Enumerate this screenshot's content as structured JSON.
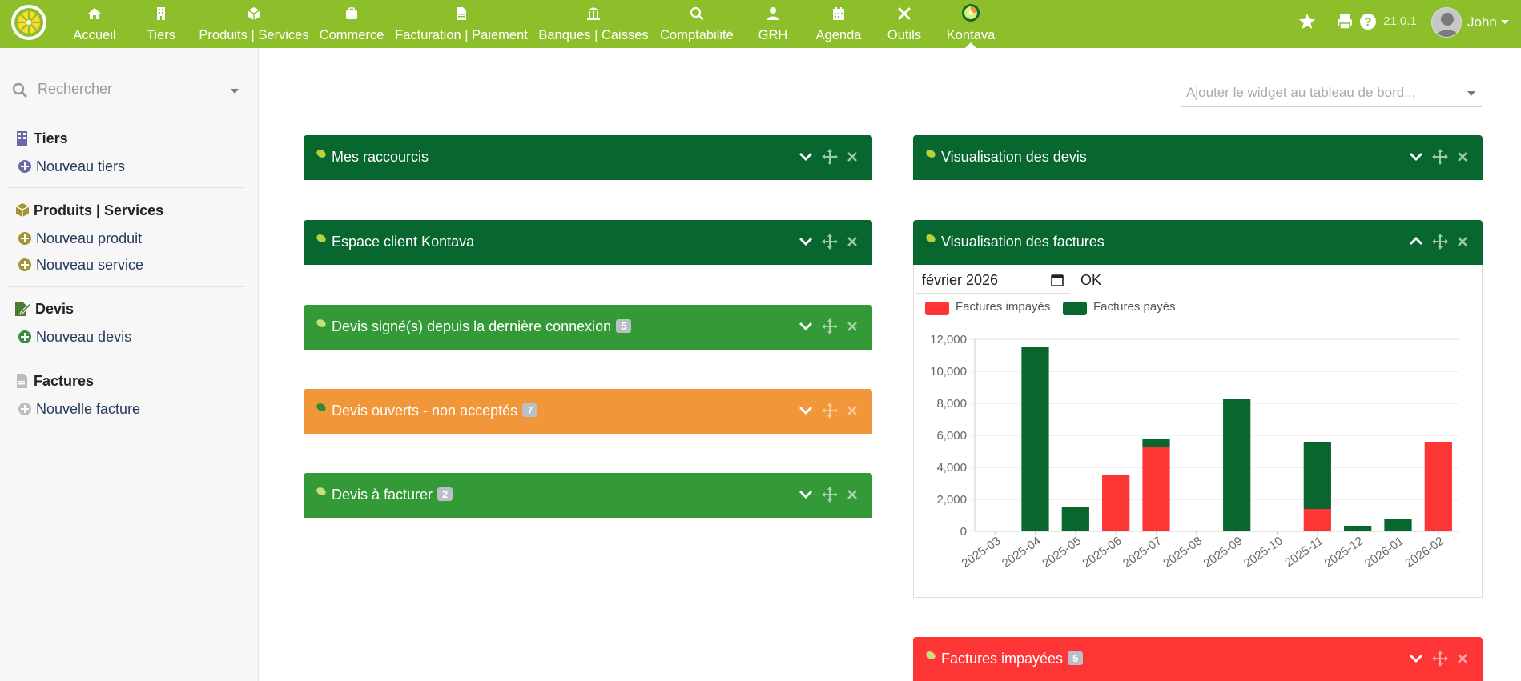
{
  "topbar": {
    "menu": [
      {
        "label": "Accueil",
        "icon": "home-icon"
      },
      {
        "label": "Tiers",
        "icon": "building-icon"
      },
      {
        "label": "Produits | Services",
        "icon": "cube-icon"
      },
      {
        "label": "Commerce",
        "icon": "suitcase-icon"
      },
      {
        "label": "Facturation | Paiement",
        "icon": "file-invoice-icon"
      },
      {
        "label": "Banques | Caisses",
        "icon": "bank-icon"
      },
      {
        "label": "Comptabilité",
        "icon": "search-dollar-icon"
      },
      {
        "label": "GRH",
        "icon": "user-tie-icon"
      },
      {
        "label": "Agenda",
        "icon": "calendar-icon"
      },
      {
        "label": "Outils",
        "icon": "tools-icon"
      },
      {
        "label": "Kontava",
        "icon": "kontava-logo-icon"
      }
    ],
    "version": "21.0.1",
    "user": "John"
  },
  "sidebar": {
    "search_placeholder": "Rechercher",
    "sections": [
      {
        "title": "Tiers",
        "links": [
          "Nouveau tiers"
        ]
      },
      {
        "title": "Produits | Services",
        "links": [
          "Nouveau produit",
          "Nouveau service"
        ]
      },
      {
        "title": "Devis",
        "links": [
          "Nouveau devis"
        ]
      },
      {
        "title": "Factures",
        "links": [
          "Nouvelle facture"
        ]
      }
    ]
  },
  "main": {
    "widget_select_placeholder": "Ajouter le widget au tableau de bord...",
    "boxes": [
      {
        "title": "Mes raccourcis",
        "badge": ""
      },
      {
        "title": "Espace client Kontava",
        "badge": ""
      },
      {
        "title": "Devis signé(s) depuis la dernière connexion",
        "badge": "5"
      },
      {
        "title": "Devis ouverts - non acceptés",
        "badge": "7"
      },
      {
        "title": "Devis à facturer",
        "badge": "2"
      },
      {
        "title": "Visualisation des devis",
        "badge": ""
      },
      {
        "title": "Visualisation des factures",
        "badge": ""
      },
      {
        "title": "Factures impayées",
        "badge": "5"
      }
    ],
    "invoice_chart": {
      "date_value": "février 2026",
      "ok_label": "OK"
    }
  },
  "colors": {
    "topbar": "#8cbf2a",
    "dark_green": "#08662f",
    "green": "#349a37",
    "orange": "#f2963a",
    "red": "#fd3535",
    "paid_series": "#08662f",
    "unpaid_series": "#fd3535"
  },
  "chart_data": {
    "type": "bar",
    "stacked": true,
    "categories": [
      "2025-03",
      "2025-04",
      "2025-05",
      "2025-06",
      "2025-07",
      "2025-08",
      "2025-09",
      "2025-10",
      "2025-11",
      "2025-12",
      "2026-01",
      "2026-02"
    ],
    "series": [
      {
        "name": "Factures impayés",
        "values": [
          0,
          0,
          0,
          3500,
          5300,
          0,
          0,
          0,
          1400,
          0,
          0,
          5600
        ]
      },
      {
        "name": "Factures payés",
        "values": [
          0,
          11500,
          1500,
          0,
          500,
          0,
          8300,
          0,
          4200,
          350,
          800,
          0
        ]
      }
    ],
    "yticks": [
      0,
      2000,
      4000,
      6000,
      8000,
      10000,
      12000
    ],
    "ytick_labels": [
      "0",
      "2,000",
      "4,000",
      "6,000",
      "8,000",
      "10,000",
      "12,000"
    ],
    "ylim": [
      0,
      12000
    ],
    "grid": true,
    "legend_position": "top-left"
  }
}
